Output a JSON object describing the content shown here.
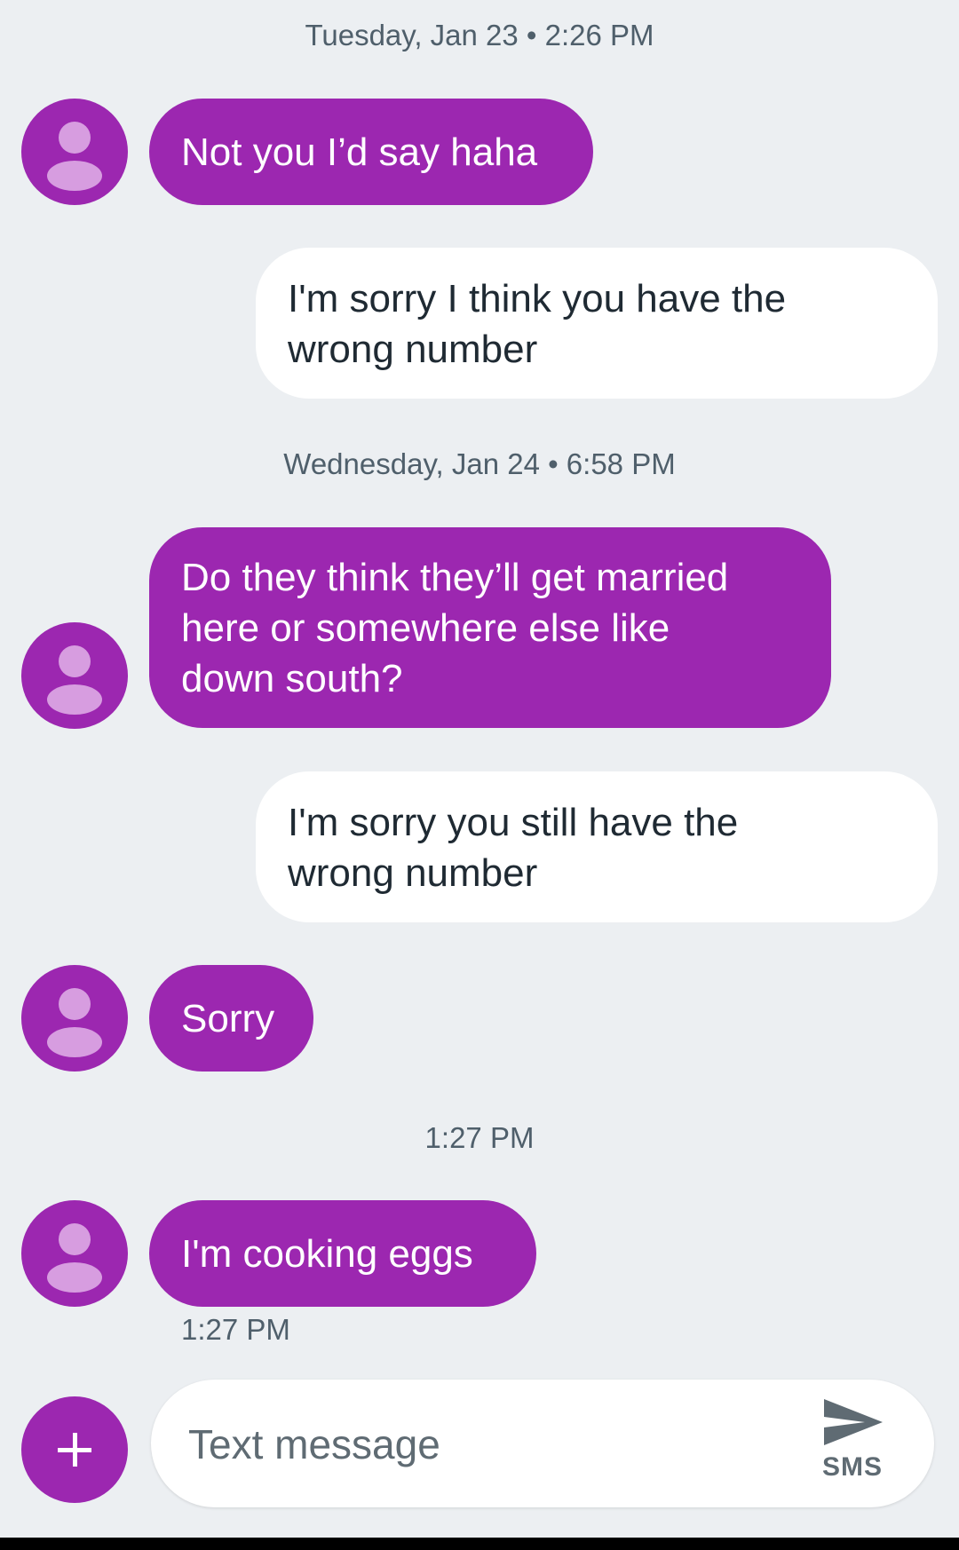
{
  "conversation": {
    "timestamp_1": "Tuesday, Jan 23 • 2:26 PM",
    "timestamp_2": "Wednesday, Jan 24 • 6:58 PM",
    "timestamp_3": "1:27 PM",
    "messages": [
      {
        "direction": "incoming",
        "text": "Not you I’d say haha"
      },
      {
        "direction": "outgoing",
        "lines": [
          "I'm sorry I think you have the",
          "wrong number"
        ]
      },
      {
        "direction": "incoming",
        "lines": [
          "Do they think they’ll get married",
          "here or somewhere else like",
          "down south?"
        ]
      },
      {
        "direction": "outgoing",
        "lines": [
          "I'm sorry you still have the",
          "wrong number"
        ]
      },
      {
        "direction": "incoming",
        "text": "Sorry"
      },
      {
        "direction": "incoming",
        "text": "I'm cooking eggs",
        "time": "1:27 PM"
      }
    ]
  },
  "composer": {
    "placeholder": "Text message",
    "send_label": "SMS"
  },
  "colors": {
    "background": "#eceff2",
    "incoming_bubble": "#9c27b0",
    "outgoing_bubble": "#ffffff",
    "avatar_glyph": "#d79de0"
  },
  "icons": {
    "avatar": "person-icon",
    "add": "plus-icon",
    "send": "send-icon"
  }
}
